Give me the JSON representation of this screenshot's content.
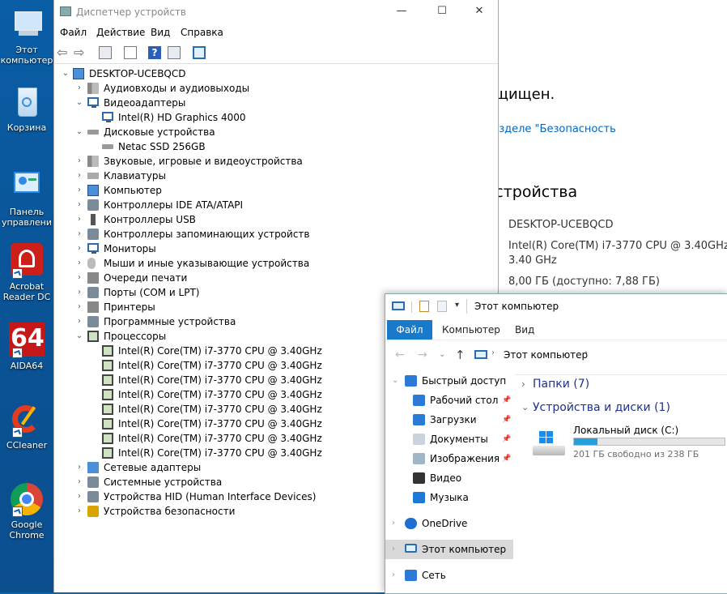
{
  "desktop": {
    "icons": [
      {
        "label": "Этот компьютер",
        "icon": "this-pc-icon"
      },
      {
        "label": "Корзина",
        "icon": "recycle-bin-icon"
      },
      {
        "label": "Панель управлени",
        "icon": "control-panel-icon"
      },
      {
        "label": "Acrobat Reader DC",
        "icon": "acrobat-icon"
      },
      {
        "label": "AIDA64",
        "icon": "aida64-icon"
      },
      {
        "label": "CCleaner",
        "icon": "ccleaner-icon"
      },
      {
        "label": "Google Chrome",
        "icon": "chrome-icon"
      }
    ],
    "aida_text": "64"
  },
  "settings": {
    "line1": "ащищен.",
    "line2": "разделе \"Безопасность",
    "heading": "устройства",
    "device_name": "DESKTOP-UCEBQCD",
    "cpu_line1": "Intel(R) Core(TM) i7-3770 CPU @ 3.40GHz",
    "cpu_line2": "3.40 GHz",
    "ram": "8,00 ГБ (доступно: 7,88 ГБ)",
    "accent": "#0067c0"
  },
  "device_manager": {
    "title": "Диспетчер устройств",
    "menu": [
      "Файл",
      "Действие",
      "Вид",
      "Справка"
    ],
    "root": "DESKTOP-UCEBQCD",
    "items": [
      {
        "label": "Аудиовходы и аудиовыходы",
        "level": 1,
        "expanded": false,
        "icon": "speaker-icon"
      },
      {
        "label": "Видеоадаптеры",
        "level": 1,
        "expanded": true,
        "icon": "monitor-icon"
      },
      {
        "label": "Intel(R) HD Graphics 4000",
        "level": 2,
        "icon": "monitor-icon"
      },
      {
        "label": "Дисковые устройства",
        "level": 1,
        "expanded": true,
        "icon": "disk-icon"
      },
      {
        "label": "Netac SSD 256GB",
        "level": 2,
        "icon": "disk-icon"
      },
      {
        "label": "Звуковые, игровые и видеоустройства",
        "level": 1,
        "expanded": false,
        "icon": "speaker-icon"
      },
      {
        "label": "Клавиатуры",
        "level": 1,
        "expanded": false,
        "icon": "keyboard-icon"
      },
      {
        "label": "Компьютер",
        "level": 1,
        "expanded": false,
        "icon": "computer-icon"
      },
      {
        "label": "Контроллеры IDE ATA/ATAPI",
        "level": 1,
        "expanded": false,
        "icon": "controller-icon"
      },
      {
        "label": "Контроллеры USB",
        "level": 1,
        "expanded": false,
        "icon": "usb-icon"
      },
      {
        "label": "Контроллеры запоминающих устройств",
        "level": 1,
        "expanded": false,
        "icon": "storage-controller-icon"
      },
      {
        "label": "Мониторы",
        "level": 1,
        "expanded": false,
        "icon": "monitor-icon"
      },
      {
        "label": "Мыши и иные указывающие устройства",
        "level": 1,
        "expanded": false,
        "icon": "mouse-icon"
      },
      {
        "label": "Очереди печати",
        "level": 1,
        "expanded": false,
        "icon": "print-queue-icon"
      },
      {
        "label": "Порты (COM и LPT)",
        "level": 1,
        "expanded": false,
        "icon": "port-icon"
      },
      {
        "label": "Принтеры",
        "level": 1,
        "expanded": false,
        "icon": "printer-icon"
      },
      {
        "label": "Программные устройства",
        "level": 1,
        "expanded": false,
        "icon": "software-device-icon"
      },
      {
        "label": "Процессоры",
        "level": 1,
        "expanded": true,
        "icon": "processor-icon"
      },
      {
        "label": "Intel(R) Core(TM) i7-3770 CPU @ 3.40GHz",
        "level": 2,
        "icon": "processor-icon"
      },
      {
        "label": "Intel(R) Core(TM) i7-3770 CPU @ 3.40GHz",
        "level": 2,
        "icon": "processor-icon"
      },
      {
        "label": "Intel(R) Core(TM) i7-3770 CPU @ 3.40GHz",
        "level": 2,
        "icon": "processor-icon"
      },
      {
        "label": "Intel(R) Core(TM) i7-3770 CPU @ 3.40GHz",
        "level": 2,
        "icon": "processor-icon"
      },
      {
        "label": "Intel(R) Core(TM) i7-3770 CPU @ 3.40GHz",
        "level": 2,
        "icon": "processor-icon"
      },
      {
        "label": "Intel(R) Core(TM) i7-3770 CPU @ 3.40GHz",
        "level": 2,
        "icon": "processor-icon"
      },
      {
        "label": "Intel(R) Core(TM) i7-3770 CPU @ 3.40GHz",
        "level": 2,
        "icon": "processor-icon"
      },
      {
        "label": "Intel(R) Core(TM) i7-3770 CPU @ 3.40GHz",
        "level": 2,
        "icon": "processor-icon"
      },
      {
        "label": "Сетевые адаптеры",
        "level": 1,
        "expanded": false,
        "icon": "network-adapter-icon"
      },
      {
        "label": "Системные устройства",
        "level": 1,
        "expanded": false,
        "icon": "system-device-icon"
      },
      {
        "label": "Устройства HID (Human Interface Devices)",
        "level": 1,
        "expanded": false,
        "icon": "hid-icon"
      },
      {
        "label": "Устройства безопасности",
        "level": 1,
        "expanded": false,
        "icon": "security-device-icon"
      }
    ]
  },
  "explorer": {
    "title": "Этот компьютер",
    "ribbon": {
      "file": "Файл",
      "tabs": [
        "Компьютер",
        "Вид"
      ]
    },
    "address": "Этот компьютер",
    "nav": [
      {
        "label": "Быстрый доступ",
        "icon": "star-icon",
        "indent": 0,
        "pinned": false,
        "chev": true
      },
      {
        "label": "Рабочий стол",
        "icon": "desktop-folder-icon",
        "indent": 1,
        "pinned": true
      },
      {
        "label": "Загрузки",
        "icon": "downloads-icon",
        "indent": 1,
        "pinned": true
      },
      {
        "label": "Документы",
        "icon": "documents-icon",
        "indent": 1,
        "pinned": true
      },
      {
        "label": "Изображения",
        "icon": "pictures-icon",
        "indent": 1,
        "pinned": true
      },
      {
        "label": "Видео",
        "icon": "video-icon",
        "indent": 1,
        "pinned": false
      },
      {
        "label": "Музыка",
        "icon": "music-icon",
        "indent": 1,
        "pinned": false
      },
      {
        "label": "OneDrive",
        "icon": "onedrive-icon",
        "indent": 0,
        "pinned": false,
        "chev": true
      },
      {
        "label": "Этот компьютер",
        "icon": "this-pc-icon",
        "indent": 0,
        "pinned": false,
        "chev": true,
        "selected": true
      },
      {
        "label": "Сеть",
        "icon": "network-icon",
        "indent": 0,
        "pinned": false,
        "chev": true
      }
    ],
    "folders_group": "Папки (7)",
    "drives_group": "Устройства и диски (1)",
    "drive": {
      "name": "Локальный диск (C:)",
      "free_text": "201 ГБ свободно из 238 ГБ",
      "used_fraction": 0.155
    },
    "accent": "#1979ca"
  }
}
